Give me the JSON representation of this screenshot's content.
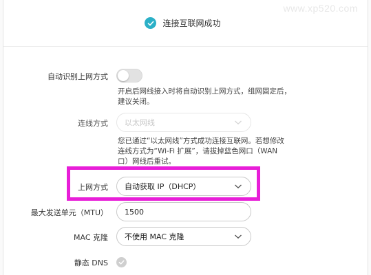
{
  "watermark": "www.xp520.com",
  "status": {
    "text": "连接互联网成功",
    "accent_color": "#2bb0c7",
    "icon": "check-circle-icon"
  },
  "auto_detect": {
    "label": "自动识别上网方式",
    "enabled": false,
    "hint_lines": [
      "开启后网线接入时将自动识别上网方式，组网固定后，",
      "建议关闭。"
    ]
  },
  "connection_type": {
    "label": "连线方式",
    "value": "以太网线",
    "disabled": true,
    "hint_lines": [
      "您已通过“以太网线”方式成功连接互联网。若想修改",
      "连线方式为“Wi-Fi 扩展”，请拔掉蓝色网口（WAN",
      "口）网线后重试。"
    ]
  },
  "internet_mode": {
    "label": "上网方式",
    "value": "自动获取 IP（DHCP）",
    "highlight_color": "#e81ed8"
  },
  "mtu": {
    "label": "最大发送单元（MTU）",
    "value": "1500"
  },
  "mac_clone": {
    "label": "MAC 克隆",
    "value": "不使用 MAC 克隆"
  },
  "static_dns": {
    "label": "静态 DNS",
    "checked": true
  }
}
